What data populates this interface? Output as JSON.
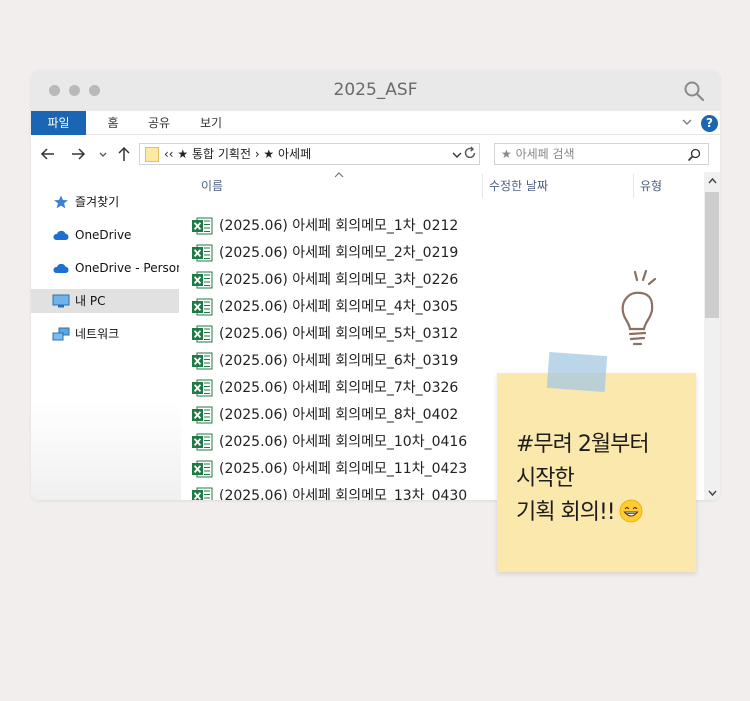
{
  "window": {
    "title": "2025_ASF"
  },
  "ribbon": {
    "tabs": [
      "파일",
      "홈",
      "공유",
      "보기"
    ],
    "help": "?"
  },
  "nav": {
    "address": "‹‹ ★ 통합 기획전 › ★ 아세페",
    "search_placeholder": "★ 아세페 검색"
  },
  "sidebar": {
    "items": [
      {
        "label": "즐겨찾기",
        "icon": "star-icon"
      },
      {
        "label": "OneDrive",
        "icon": "cloud-icon"
      },
      {
        "label": "OneDrive - Personal",
        "icon": "cloud-icon"
      },
      {
        "label": "내 PC",
        "icon": "monitor-icon",
        "selected": true
      },
      {
        "label": "네트워크",
        "icon": "network-icon"
      }
    ]
  },
  "columns": {
    "name": "이름",
    "date": "수정한 날짜",
    "type": "유형"
  },
  "files": [
    "(2025.06) 아세페 회의메모_1차_0212",
    "(2025.06) 아세페 회의메모_2차_0219",
    "(2025.06) 아세페 회의메모_3차_0226",
    "(2025.06) 아세페 회의메모_4차_0305",
    "(2025.06) 아세페 회의메모_5차_0312",
    "(2025.06) 아세페 회의메모_6차_0319",
    "(2025.06) 아세페 회의메모_7차_0326",
    "(2025.06) 아세페 회의메모_8차_0402",
    "(2025.06) 아세페 회의메모_10차_0416",
    "(2025.06) 아세페 회의메모_11차_0423",
    "(2025.06) 아세페 회의메모_13차_0430"
  ],
  "note": {
    "lines": [
      "#무려 2월부터",
      "시작한",
      "기획 회의!!"
    ],
    "emoji": "grinning-face-emoji"
  },
  "colors": {
    "accent": "#1a66b5",
    "sticky": "#fae8ac",
    "tape": "#a5c8e1",
    "excel": "#1f7a45"
  }
}
